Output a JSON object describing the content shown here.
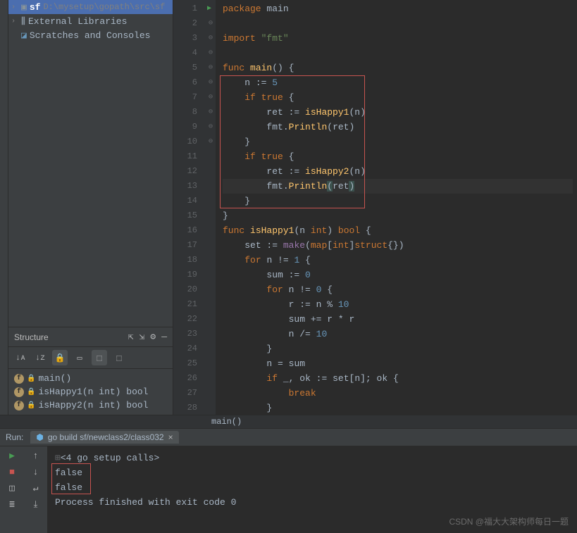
{
  "project": {
    "root_name": "sf",
    "root_path": "D:\\mysetup\\gopath\\src\\sf",
    "external_libs": "External Libraries",
    "scratches": "Scratches and Consoles"
  },
  "structure": {
    "title": "Structure",
    "items": [
      {
        "name": "main()"
      },
      {
        "name": "isHappy1(n int) bool"
      },
      {
        "name": "isHappy2(n int) bool"
      }
    ]
  },
  "editor": {
    "lines": {
      "1": [
        [
          "kw",
          "package"
        ],
        [
          "punc",
          " "
        ],
        [
          "ident",
          "main"
        ]
      ],
      "2": [],
      "3": [
        [
          "kw",
          "import"
        ],
        [
          "punc",
          " "
        ],
        [
          "str",
          "\"fmt\""
        ]
      ],
      "4": [],
      "5": [
        [
          "kw",
          "func"
        ],
        [
          "punc",
          " "
        ],
        [
          "fn",
          "main"
        ],
        [
          "punc",
          "() {"
        ]
      ],
      "6": [
        [
          "punc",
          "    "
        ],
        [
          "ident",
          "n"
        ],
        [
          "punc",
          " := "
        ],
        [
          "num",
          "5"
        ]
      ],
      "7": [
        [
          "punc",
          "    "
        ],
        [
          "kw",
          "if"
        ],
        [
          "punc",
          " "
        ],
        [
          "kw",
          "true"
        ],
        [
          "punc",
          " {"
        ]
      ],
      "8": [
        [
          "punc",
          "        "
        ],
        [
          "ident",
          "ret"
        ],
        [
          "punc",
          " := "
        ],
        [
          "fn",
          "isHappy1"
        ],
        [
          "punc",
          "("
        ],
        [
          "ident",
          "n"
        ],
        [
          "punc",
          ")"
        ]
      ],
      "9": [
        [
          "punc",
          "        "
        ],
        [
          "ident",
          "fmt"
        ],
        [
          "punc",
          "."
        ],
        [
          "fn",
          "Println"
        ],
        [
          "punc",
          "("
        ],
        [
          "ident",
          "ret"
        ],
        [
          "punc",
          ")"
        ]
      ],
      "10": [
        [
          "punc",
          "    }"
        ]
      ],
      "11": [
        [
          "punc",
          "    "
        ],
        [
          "kw",
          "if"
        ],
        [
          "punc",
          " "
        ],
        [
          "kw",
          "true"
        ],
        [
          "punc",
          " {"
        ]
      ],
      "12": [
        [
          "punc",
          "        "
        ],
        [
          "ident",
          "ret"
        ],
        [
          "punc",
          " := "
        ],
        [
          "fn",
          "isHappy2"
        ],
        [
          "punc",
          "("
        ],
        [
          "ident",
          "n"
        ],
        [
          "punc",
          ")"
        ]
      ],
      "13": [
        [
          "punc",
          "        "
        ],
        [
          "ident",
          "fmt"
        ],
        [
          "punc",
          "."
        ],
        [
          "fn",
          "Println"
        ],
        [
          "paren-hl",
          "("
        ],
        [
          "ident",
          "ret"
        ],
        [
          "paren-hl",
          ")"
        ]
      ],
      "14": [
        [
          "punc",
          "    }"
        ]
      ],
      "15": [
        [
          "punc",
          "}"
        ]
      ],
      "16": [
        [
          "kw",
          "func"
        ],
        [
          "punc",
          " "
        ],
        [
          "fn",
          "isHappy1"
        ],
        [
          "punc",
          "("
        ],
        [
          "param",
          "n"
        ],
        [
          "punc",
          " "
        ],
        [
          "typ",
          "int"
        ],
        [
          "punc",
          ") "
        ],
        [
          "typ",
          "bool"
        ],
        [
          "punc",
          " {"
        ]
      ],
      "17": [
        [
          "punc",
          "    "
        ],
        [
          "ident",
          "set"
        ],
        [
          "punc",
          " := "
        ],
        [
          "builtin",
          "make"
        ],
        [
          "punc",
          "("
        ],
        [
          "typ",
          "map"
        ],
        [
          "punc",
          "["
        ],
        [
          "typ",
          "int"
        ],
        [
          "punc",
          "]"
        ],
        [
          "typ",
          "struct"
        ],
        [
          "punc",
          "{})"
        ]
      ],
      "18": [
        [
          "punc",
          "    "
        ],
        [
          "kw",
          "for"
        ],
        [
          "punc",
          " "
        ],
        [
          "ident",
          "n"
        ],
        [
          "punc",
          " != "
        ],
        [
          "num",
          "1"
        ],
        [
          "punc",
          " {"
        ]
      ],
      "19": [
        [
          "punc",
          "        "
        ],
        [
          "ident",
          "sum"
        ],
        [
          "punc",
          " := "
        ],
        [
          "num",
          "0"
        ]
      ],
      "20": [
        [
          "punc",
          "        "
        ],
        [
          "kw",
          "for"
        ],
        [
          "punc",
          " "
        ],
        [
          "ident",
          "n"
        ],
        [
          "punc",
          " != "
        ],
        [
          "num",
          "0"
        ],
        [
          "punc",
          " {"
        ]
      ],
      "21": [
        [
          "punc",
          "            "
        ],
        [
          "ident",
          "r"
        ],
        [
          "punc",
          " := "
        ],
        [
          "ident",
          "n"
        ],
        [
          "punc",
          " % "
        ],
        [
          "num",
          "10"
        ]
      ],
      "22": [
        [
          "punc",
          "            "
        ],
        [
          "ident",
          "sum"
        ],
        [
          "punc",
          " += "
        ],
        [
          "ident",
          "r"
        ],
        [
          "punc",
          " * "
        ],
        [
          "ident",
          "r"
        ]
      ],
      "23": [
        [
          "punc",
          "            "
        ],
        [
          "ident",
          "n"
        ],
        [
          "punc",
          " /= "
        ],
        [
          "num",
          "10"
        ]
      ],
      "24": [
        [
          "punc",
          "        }"
        ]
      ],
      "25": [
        [
          "punc",
          "        "
        ],
        [
          "ident",
          "n"
        ],
        [
          "punc",
          " = "
        ],
        [
          "ident",
          "sum"
        ]
      ],
      "26": [
        [
          "punc",
          "        "
        ],
        [
          "kw",
          "if"
        ],
        [
          "punc",
          " "
        ],
        [
          "ident",
          "_"
        ],
        [
          "punc",
          ", "
        ],
        [
          "ident",
          "ok"
        ],
        [
          "punc",
          " := "
        ],
        [
          "ident",
          "set"
        ],
        [
          "punc",
          "["
        ],
        [
          "ident",
          "n"
        ],
        [
          "punc",
          "]; "
        ],
        [
          "ident",
          "ok"
        ],
        [
          "punc",
          " {"
        ]
      ],
      "27": [
        [
          "punc",
          "            "
        ],
        [
          "kw",
          "break"
        ]
      ],
      "28": [
        [
          "punc",
          "        }"
        ]
      ]
    },
    "fold_markers": {
      "5": "⊖",
      "7": "⊖",
      "11": "⊖",
      "13": "⊖",
      "16": "⊖",
      "18": "⊖",
      "20": "⊖",
      "24": "⊖",
      "26": "⊖",
      "28": "⊖"
    },
    "breadcrumb": "main()"
  },
  "run": {
    "label": "Run:",
    "tab_name": "go build sf/newclass2/class032",
    "output": [
      "<4 go setup calls>",
      "false",
      "false",
      "",
      "Process finished with exit code 0"
    ]
  },
  "watermark": "CSDN @福大大架构师每日一题"
}
